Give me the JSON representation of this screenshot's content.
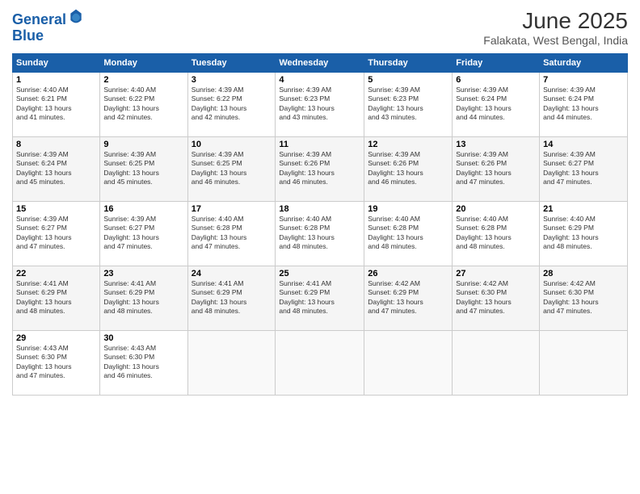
{
  "logo": {
    "line1": "General",
    "line2": "Blue"
  },
  "title": "June 2025",
  "subtitle": "Falakata, West Bengal, India",
  "days_of_week": [
    "Sunday",
    "Monday",
    "Tuesday",
    "Wednesday",
    "Thursday",
    "Friday",
    "Saturday"
  ],
  "weeks": [
    [
      {
        "num": "1",
        "sunrise": "4:40 AM",
        "sunset": "6:21 PM",
        "daylight": "13 hours and 41 minutes."
      },
      {
        "num": "2",
        "sunrise": "4:40 AM",
        "sunset": "6:22 PM",
        "daylight": "13 hours and 42 minutes."
      },
      {
        "num": "3",
        "sunrise": "4:39 AM",
        "sunset": "6:22 PM",
        "daylight": "13 hours and 42 minutes."
      },
      {
        "num": "4",
        "sunrise": "4:39 AM",
        "sunset": "6:23 PM",
        "daylight": "13 hours and 43 minutes."
      },
      {
        "num": "5",
        "sunrise": "4:39 AM",
        "sunset": "6:23 PM",
        "daylight": "13 hours and 43 minutes."
      },
      {
        "num": "6",
        "sunrise": "4:39 AM",
        "sunset": "6:24 PM",
        "daylight": "13 hours and 44 minutes."
      },
      {
        "num": "7",
        "sunrise": "4:39 AM",
        "sunset": "6:24 PM",
        "daylight": "13 hours and 44 minutes."
      }
    ],
    [
      {
        "num": "8",
        "sunrise": "4:39 AM",
        "sunset": "6:24 PM",
        "daylight": "13 hours and 45 minutes."
      },
      {
        "num": "9",
        "sunrise": "4:39 AM",
        "sunset": "6:25 PM",
        "daylight": "13 hours and 45 minutes."
      },
      {
        "num": "10",
        "sunrise": "4:39 AM",
        "sunset": "6:25 PM",
        "daylight": "13 hours and 46 minutes."
      },
      {
        "num": "11",
        "sunrise": "4:39 AM",
        "sunset": "6:26 PM",
        "daylight": "13 hours and 46 minutes."
      },
      {
        "num": "12",
        "sunrise": "4:39 AM",
        "sunset": "6:26 PM",
        "daylight": "13 hours and 46 minutes."
      },
      {
        "num": "13",
        "sunrise": "4:39 AM",
        "sunset": "6:26 PM",
        "daylight": "13 hours and 47 minutes."
      },
      {
        "num": "14",
        "sunrise": "4:39 AM",
        "sunset": "6:27 PM",
        "daylight": "13 hours and 47 minutes."
      }
    ],
    [
      {
        "num": "15",
        "sunrise": "4:39 AM",
        "sunset": "6:27 PM",
        "daylight": "13 hours and 47 minutes."
      },
      {
        "num": "16",
        "sunrise": "4:39 AM",
        "sunset": "6:27 PM",
        "daylight": "13 hours and 47 minutes."
      },
      {
        "num": "17",
        "sunrise": "4:40 AM",
        "sunset": "6:28 PM",
        "daylight": "13 hours and 47 minutes."
      },
      {
        "num": "18",
        "sunrise": "4:40 AM",
        "sunset": "6:28 PM",
        "daylight": "13 hours and 48 minutes."
      },
      {
        "num": "19",
        "sunrise": "4:40 AM",
        "sunset": "6:28 PM",
        "daylight": "13 hours and 48 minutes."
      },
      {
        "num": "20",
        "sunrise": "4:40 AM",
        "sunset": "6:28 PM",
        "daylight": "13 hours and 48 minutes."
      },
      {
        "num": "21",
        "sunrise": "4:40 AM",
        "sunset": "6:29 PM",
        "daylight": "13 hours and 48 minutes."
      }
    ],
    [
      {
        "num": "22",
        "sunrise": "4:41 AM",
        "sunset": "6:29 PM",
        "daylight": "13 hours and 48 minutes."
      },
      {
        "num": "23",
        "sunrise": "4:41 AM",
        "sunset": "6:29 PM",
        "daylight": "13 hours and 48 minutes."
      },
      {
        "num": "24",
        "sunrise": "4:41 AM",
        "sunset": "6:29 PM",
        "daylight": "13 hours and 48 minutes."
      },
      {
        "num": "25",
        "sunrise": "4:41 AM",
        "sunset": "6:29 PM",
        "daylight": "13 hours and 48 minutes."
      },
      {
        "num": "26",
        "sunrise": "4:42 AM",
        "sunset": "6:29 PM",
        "daylight": "13 hours and 47 minutes."
      },
      {
        "num": "27",
        "sunrise": "4:42 AM",
        "sunset": "6:30 PM",
        "daylight": "13 hours and 47 minutes."
      },
      {
        "num": "28",
        "sunrise": "4:42 AM",
        "sunset": "6:30 PM",
        "daylight": "13 hours and 47 minutes."
      }
    ],
    [
      {
        "num": "29",
        "sunrise": "4:43 AM",
        "sunset": "6:30 PM",
        "daylight": "13 hours and 47 minutes."
      },
      {
        "num": "30",
        "sunrise": "4:43 AM",
        "sunset": "6:30 PM",
        "daylight": "13 hours and 46 minutes."
      },
      null,
      null,
      null,
      null,
      null
    ]
  ],
  "labels": {
    "sunrise": "Sunrise:",
    "sunset": "Sunset:",
    "daylight": "Daylight:"
  }
}
